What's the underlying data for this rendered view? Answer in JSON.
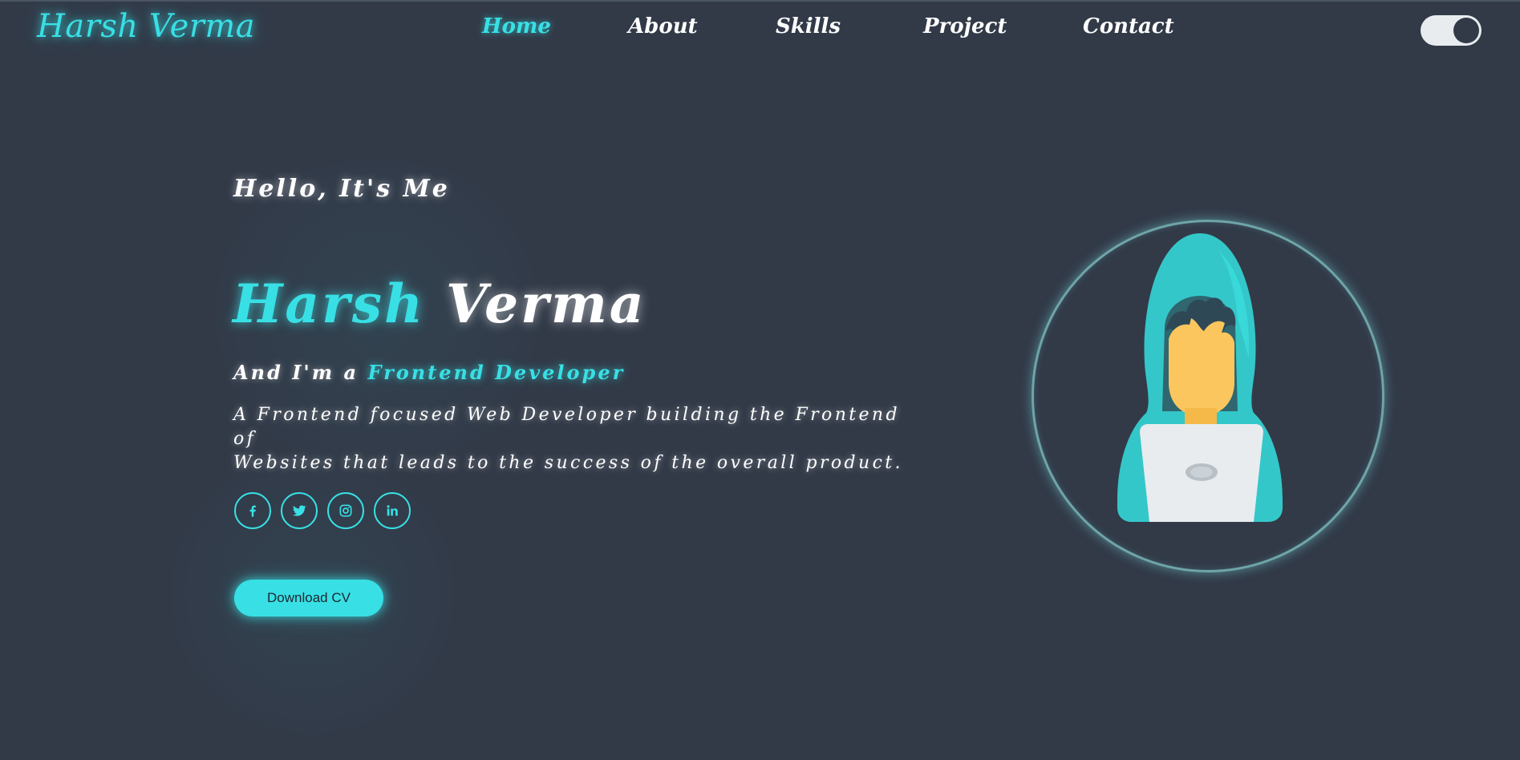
{
  "brand": {
    "logo": "Harsh Verma"
  },
  "nav": {
    "items": [
      {
        "label": "Home",
        "active": true
      },
      {
        "label": "About",
        "active": false
      },
      {
        "label": "Skills",
        "active": false
      },
      {
        "label": "Project",
        "active": false
      },
      {
        "label": "Contact",
        "active": false
      }
    ]
  },
  "theme_toggle": {
    "state": "on"
  },
  "hero": {
    "greeting": "Hello, It's Me",
    "name_first": "Harsh",
    "name_last": "Verma",
    "role_prefix": "And I'm a",
    "role_highlight": "Frontend Developer",
    "description_line1": "A Frontend focused Web Developer building the Frontend of",
    "description_line2": "Websites that leads to the success of the overall product.",
    "social": [
      "facebook-icon",
      "twitter-icon",
      "instagram-icon",
      "linkedin-icon"
    ],
    "cta_label": "Download CV"
  },
  "colors": {
    "background": "#323a48",
    "accent": "#38e0e5",
    "text": "#ffffff",
    "toggle": "#e8ecef"
  }
}
